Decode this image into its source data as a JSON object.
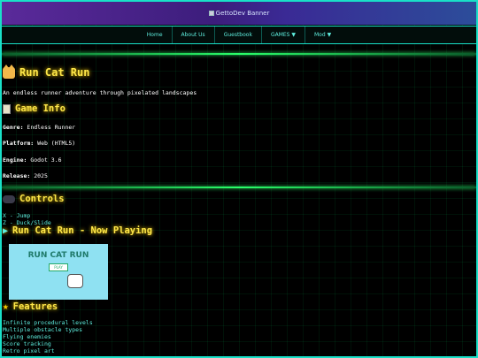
{
  "banner": {
    "alt": "GettoDev Banner"
  },
  "nav": {
    "items": [
      "Home",
      "About Us",
      "Guestbook",
      "GAMES ▼",
      "Mod ▼"
    ]
  },
  "game": {
    "title": "Run Cat Run",
    "description": "An endless runner adventure through pixelated landscapes"
  },
  "info": {
    "heading": "Game Info",
    "rows": [
      {
        "label": "Genre:",
        "value": "Endless Runner"
      },
      {
        "label": "Platform:",
        "value": "Web (HTML5)"
      },
      {
        "label": "Engine:",
        "value": "Godot 3.6"
      },
      {
        "label": "Release:",
        "value": "2025"
      }
    ]
  },
  "controls": {
    "heading": "Controls",
    "items": [
      "X - Jump",
      "Z - Duck/Slide"
    ]
  },
  "playing": {
    "heading": "Run Cat Run - Now Playing",
    "screen_title": "RUN CAT RUN",
    "screen_button": "PLAY"
  },
  "features": {
    "heading": "Features",
    "items": [
      "Infinite procedural levels",
      "Multiple obstacle types",
      "Flying enemies",
      "Score tracking",
      "Retro pixel art"
    ]
  }
}
